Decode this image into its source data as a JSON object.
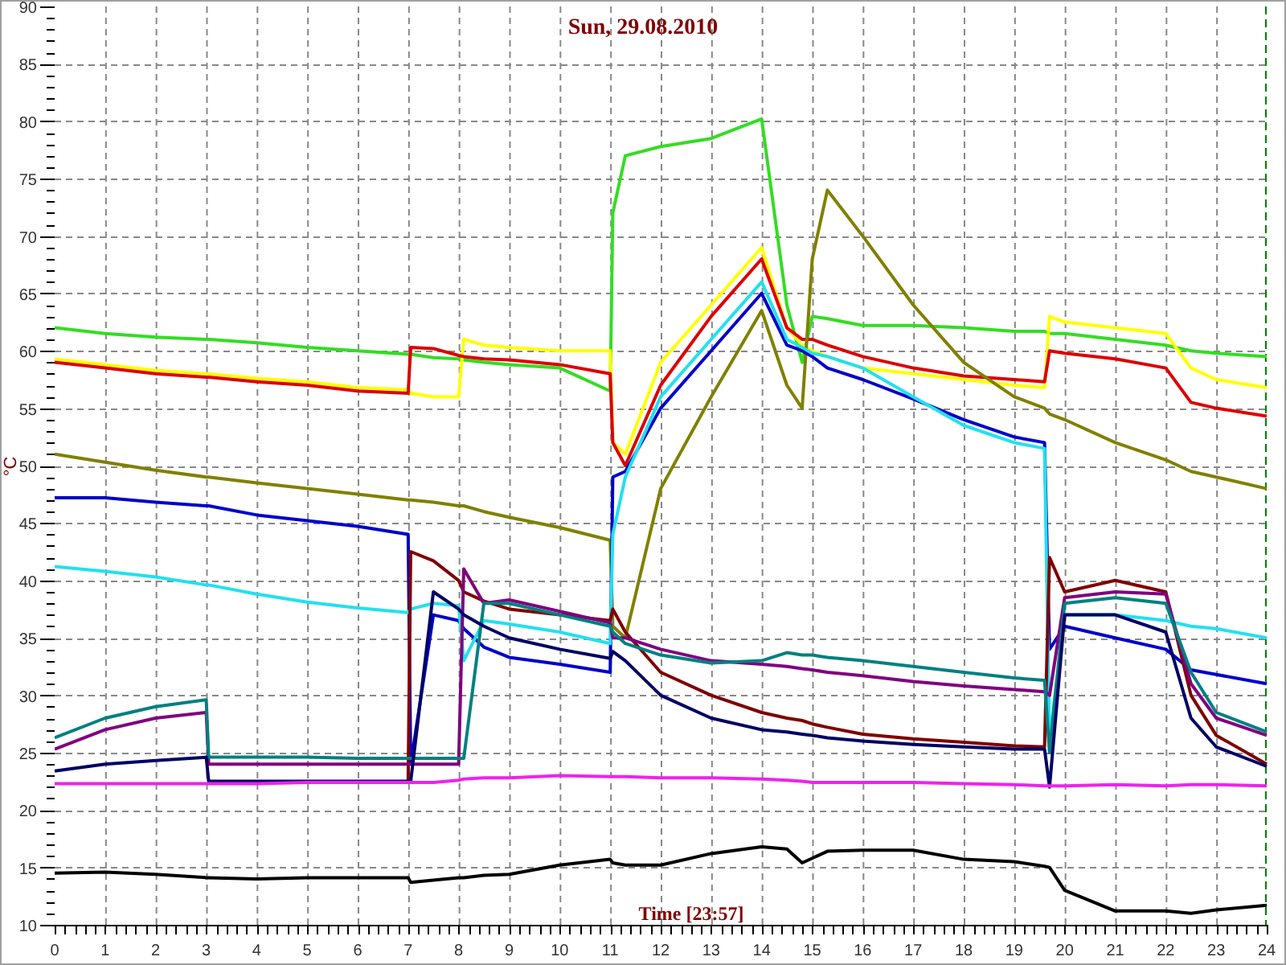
{
  "chart": {
    "chart_data": {
      "type": "line",
      "grid": true,
      "title": "Sun, 29.08.2010",
      "xlabel": "Time [23:57]",
      "ylabel": "°C",
      "xlim": [
        0,
        24
      ],
      "ylim": [
        10,
        90
      ],
      "xticks": [
        0,
        1,
        2,
        3,
        4,
        5,
        6,
        7,
        8,
        9,
        10,
        11,
        12,
        13,
        14,
        15,
        16,
        17,
        18,
        19,
        20,
        21,
        22,
        23,
        24
      ],
      "yticks": [
        10,
        15,
        20,
        25,
        30,
        35,
        40,
        45,
        50,
        55,
        60,
        65,
        70,
        75,
        80,
        85,
        90
      ],
      "x": [
        0,
        1,
        2,
        3,
        3.05,
        4,
        5,
        6,
        7,
        7.05,
        7.5,
        8,
        8.1,
        8.5,
        9,
        10,
        11,
        11.05,
        11.3,
        12,
        13,
        14,
        14.5,
        14.8,
        15,
        15.3,
        16,
        17,
        18,
        19,
        19.6,
        19.7,
        20,
        21,
        22,
        22.5,
        23,
        24
      ],
      "series": [
        {
          "color": "#33dd22",
          "values": [
            62,
            61.5,
            61.2,
            61,
            61,
            60.7,
            60.3,
            60,
            59.7,
            59.7,
            59.4,
            59.3,
            59.2,
            59,
            58.8,
            58.5,
            56.5,
            72,
            77,
            77.8,
            78.5,
            80.2,
            64,
            59,
            63,
            62.8,
            62.2,
            62.2,
            62,
            61.7,
            61.7,
            61.5,
            61.5,
            61,
            60.5,
            60,
            59.8,
            59.5
          ]
        },
        {
          "color": "#ffff00",
          "values": [
            59.3,
            58.8,
            58.3,
            58,
            58,
            57.6,
            57.3,
            56.8,
            56.6,
            56.3,
            56,
            56,
            61,
            60.5,
            60.3,
            60,
            60,
            52,
            51,
            59,
            64,
            69,
            62,
            60.5,
            60,
            59.5,
            58.5,
            58,
            57.5,
            57,
            56.8,
            63,
            62.5,
            62,
            61.5,
            58.5,
            57.5,
            56.8
          ]
        },
        {
          "color": "#dd0000",
          "values": [
            59,
            58.5,
            58,
            57.7,
            57.7,
            57.3,
            57,
            56.5,
            56.3,
            60.3,
            60.2,
            59.6,
            59.5,
            59.3,
            59.2,
            58.8,
            58,
            52,
            50,
            57,
            63,
            68,
            62,
            61,
            61,
            60.5,
            59.5,
            58.5,
            57.8,
            57.5,
            57.3,
            60,
            59.8,
            59.3,
            58.5,
            55.5,
            55,
            54.3
          ]
        },
        {
          "color": "#808000",
          "values": [
            51,
            50.3,
            49.6,
            49,
            49,
            48.5,
            48,
            47.5,
            47,
            47,
            46.8,
            46.5,
            46.5,
            46,
            45.5,
            44.6,
            43.5,
            36,
            35,
            48,
            56,
            63.5,
            57,
            55,
            68,
            74,
            70,
            64,
            59,
            56,
            55,
            54.5,
            54,
            52,
            50.5,
            49.5,
            49,
            48
          ]
        },
        {
          "color": "#0000cc",
          "values": [
            47.2,
            47.2,
            46.8,
            46.5,
            46.5,
            45.7,
            45.2,
            44.7,
            44,
            24,
            37,
            36.5,
            35.8,
            34.2,
            33.3,
            32.7,
            32,
            49,
            49.5,
            55,
            60,
            65,
            60.5,
            60,
            59.5,
            58.5,
            57.5,
            55.8,
            54,
            52.5,
            52,
            34,
            36,
            35,
            34,
            32.2,
            31.8,
            31
          ]
        },
        {
          "color": "#22e0f0",
          "values": [
            41.2,
            40.8,
            40.3,
            39.6,
            39.6,
            38.8,
            38.1,
            37.6,
            37.2,
            37.5,
            38,
            37.8,
            33,
            36.5,
            36.2,
            35.5,
            34.5,
            44,
            49,
            56,
            61,
            66,
            61,
            60.3,
            59.8,
            59.5,
            58.5,
            56,
            53.5,
            52,
            51.5,
            26,
            37,
            37,
            36.5,
            36,
            35.8,
            35
          ]
        },
        {
          "color": "#800000",
          "values": [
            null,
            null,
            null,
            null,
            null,
            null,
            null,
            null,
            22.5,
            42.5,
            41.7,
            40,
            39,
            38.2,
            37.5,
            37,
            36.5,
            37.5,
            35.5,
            32,
            30,
            28.5,
            28,
            27.8,
            27.5,
            27.2,
            26.6,
            26.2,
            25.9,
            25.6,
            25.5,
            42,
            39,
            40,
            39,
            30,
            26.5,
            24
          ]
        },
        {
          "color": "#800080",
          "values": [
            25.3,
            27,
            28,
            28.5,
            24,
            24,
            24,
            24,
            24,
            24,
            24,
            24,
            41,
            38,
            38.3,
            37.3,
            36.3,
            35,
            35,
            34,
            33,
            32.7,
            32.5,
            32.3,
            32.2,
            32,
            31.7,
            31.2,
            30.8,
            30.5,
            30.3,
            30,
            38.5,
            39,
            38.8,
            31,
            28,
            26.5
          ]
        },
        {
          "color": "#008080",
          "values": [
            26.3,
            28,
            29,
            29.6,
            24.6,
            24.6,
            24.6,
            24.5,
            24.5,
            24.5,
            24.5,
            24.5,
            24.5,
            38,
            38,
            37,
            36,
            35.5,
            34.5,
            33.5,
            32.8,
            33,
            33.7,
            33.5,
            33.5,
            33.3,
            33,
            32.5,
            32,
            31.5,
            31.3,
            25,
            38,
            38.5,
            38,
            32,
            28.5,
            26.8
          ]
        },
        {
          "color": "#000066",
          "values": [
            23.4,
            24,
            24.3,
            24.6,
            22.5,
            22.5,
            22.5,
            22.5,
            22.5,
            22.5,
            39,
            37.5,
            37,
            36,
            35,
            34,
            33.2,
            33.8,
            33,
            30,
            28,
            27,
            26.8,
            26.6,
            26.5,
            26.3,
            26,
            25.7,
            25.5,
            25.3,
            25.3,
            22,
            37,
            37,
            35.5,
            28,
            25.5,
            23.8
          ]
        },
        {
          "color": "#ee22ee",
          "values": [
            22.3,
            22.3,
            22.3,
            22.3,
            22.3,
            22.3,
            22.4,
            22.4,
            22.4,
            22.4,
            22.4,
            22.6,
            22.7,
            22.8,
            22.8,
            23,
            22.9,
            22.9,
            22.9,
            22.8,
            22.8,
            22.7,
            22.6,
            22.5,
            22.4,
            22.4,
            22.4,
            22.4,
            22.3,
            22.2,
            22.1,
            22.1,
            22.1,
            22.2,
            22.1,
            22.2,
            22.2,
            22.1
          ]
        },
        {
          "color": "#000000",
          "values": [
            14.5,
            14.6,
            14.4,
            14.1,
            14.1,
            14,
            14.1,
            14.1,
            14.1,
            13.7,
            13.9,
            14.1,
            14.1,
            14.3,
            14.4,
            15.2,
            15.7,
            15.4,
            15.2,
            15.2,
            16.2,
            16.8,
            16.6,
            15.4,
            15.8,
            16.4,
            16.5,
            16.5,
            15.7,
            15.5,
            15.1,
            15,
            13,
            11.2,
            11.2,
            11,
            11.3,
            11.7
          ]
        }
      ]
    }
  }
}
